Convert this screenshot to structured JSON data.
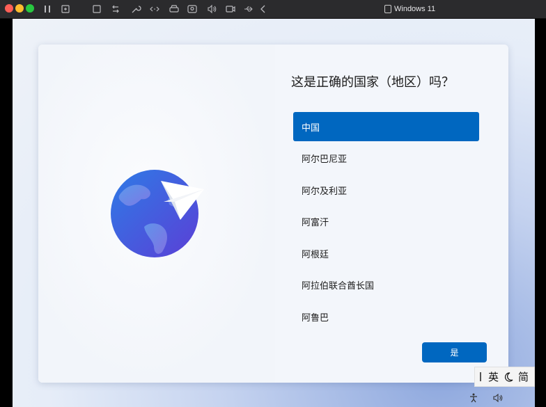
{
  "window": {
    "title": "Windows 11"
  },
  "toolbar": {
    "icons": [
      "pause-icon",
      "snapshot-icon",
      "fullscreen-icon",
      "share-icon",
      "settings-icon",
      "code-icon",
      "disk-icon",
      "camera-icon",
      "volume-icon",
      "video-icon",
      "usb-icon",
      "back-icon"
    ]
  },
  "oobe": {
    "heading": "这是正确的国家（地区）吗？",
    "regions": [
      {
        "label": "中国",
        "selected": true
      },
      {
        "label": "阿尔巴尼亚",
        "selected": false
      },
      {
        "label": "阿尔及利亚",
        "selected": false
      },
      {
        "label": "阿富汗",
        "selected": false
      },
      {
        "label": "阿根廷",
        "selected": false
      },
      {
        "label": "阿拉伯联合酋长国",
        "selected": false
      },
      {
        "label": "阿鲁巴",
        "selected": false
      }
    ],
    "yes_label": "是",
    "accent": "#0067c0"
  },
  "ime": {
    "lang": "英",
    "mode": "简"
  }
}
